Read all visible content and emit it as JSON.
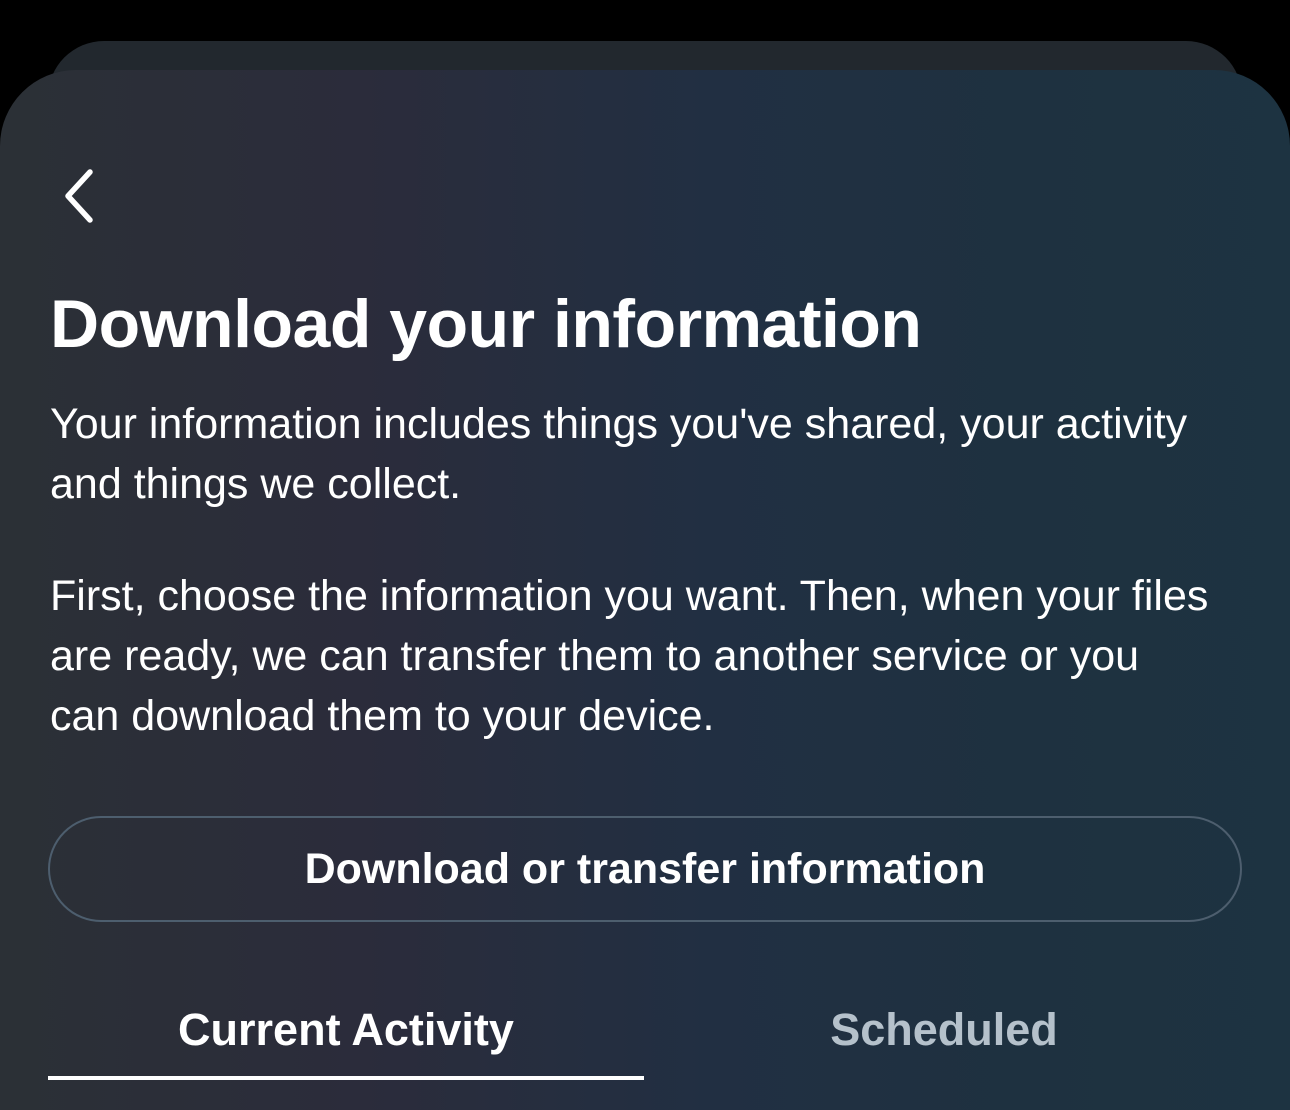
{
  "header": {
    "back_icon": "chevron-left-icon",
    "title": "Download your information"
  },
  "description": {
    "paragraph_1": "Your information includes things you've shared, your activity and things we collect.",
    "paragraph_2": "First, choose the information you want. Then, when your files are ready, we can transfer them to another service or you can download them to your device."
  },
  "actions": {
    "download_transfer_label": "Download or transfer information"
  },
  "tabs": [
    {
      "label": "Current Activity",
      "selected": true
    },
    {
      "label": "Scheduled",
      "selected": false
    }
  ],
  "colors": {
    "page_background": "#000000",
    "sheet_background_start": "#2b3036",
    "sheet_background_end": "#1d3341",
    "text_primary": "#ffffff",
    "text_inactive_tab": "#b5c1cb",
    "button_border": "#4d5e6e"
  }
}
